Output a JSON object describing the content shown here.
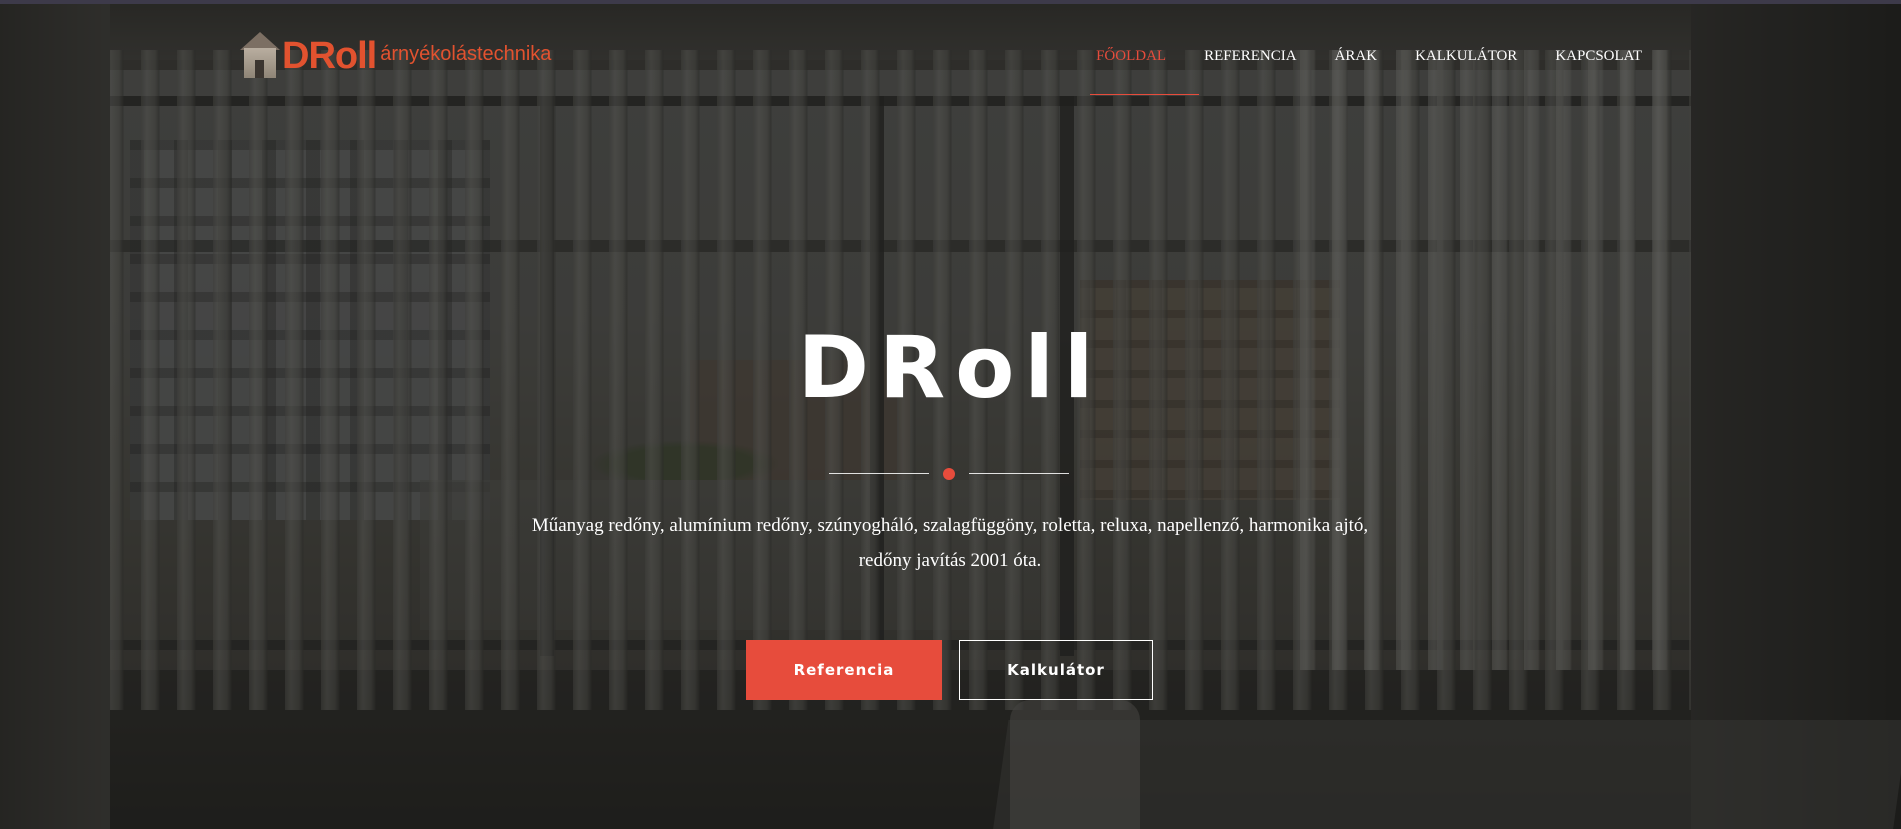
{
  "brand": {
    "logo_main": "DRoll",
    "logo_sub": "árnyékolástechnika",
    "accent_color": "#e74c3c"
  },
  "nav": {
    "items": [
      {
        "label": "FŐOLDAL",
        "active": true
      },
      {
        "label": "REFERENCIA",
        "active": false
      },
      {
        "label": "ÁRAK",
        "active": false
      },
      {
        "label": "KALKULÁTOR",
        "active": false
      },
      {
        "label": "KAPCSOLAT",
        "active": false
      }
    ]
  },
  "hero": {
    "title": "DRoll",
    "description": "Műanyag redőny, alumínium redőny, szúnyogháló, szalagfüggöny, roletta, reluxa, napellenző, harmonika ajtó, redőny javítás 2001 óta.",
    "buttons": {
      "primary_label": "Referencia",
      "secondary_label": "Kalkulátor"
    }
  }
}
